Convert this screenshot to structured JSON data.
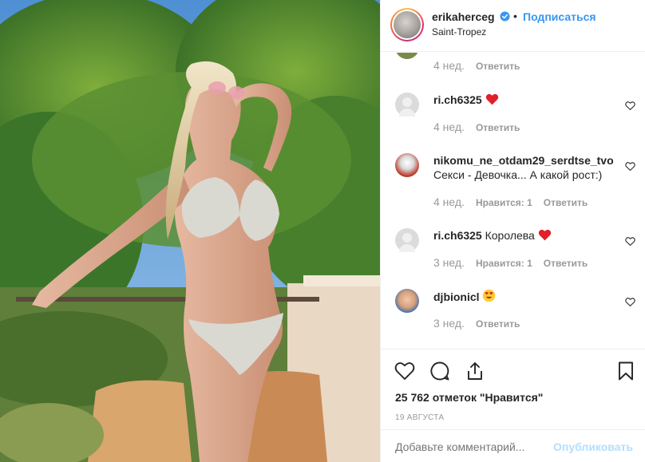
{
  "post": {
    "username": "erikaherceg",
    "subscribe_label": "Подписаться",
    "location": "Saint-Tropez",
    "dot": "•"
  },
  "comments": [
    {
      "time": "4 нед.",
      "reply_label": "Ответить"
    },
    {
      "user": "ri.ch6325",
      "text": "",
      "time": "4 нед.",
      "reply_label": "Ответить",
      "emoji": "heart"
    },
    {
      "user": "nikomu_ne_otdam29_serdtse_tvo",
      "text": "Секси - Девочка... А какой рост:)",
      "time": "4 нед.",
      "likes_label": "Нравится: 1",
      "reply_label": "Ответить"
    },
    {
      "user": "ri.ch6325",
      "text": "Королева",
      "time": "3 нед.",
      "likes_label": "Нравится: 1",
      "reply_label": "Ответить",
      "emoji": "heart"
    },
    {
      "user": "djbionicl",
      "text": "",
      "time": "3 нед.",
      "reply_label": "Ответить",
      "emoji": "heart-eyes"
    }
  ],
  "actions": {
    "icons": [
      "heart-icon",
      "comment-icon",
      "share-icon",
      "bookmark-icon"
    ]
  },
  "likes": "25 762 отметок \"Нравится\"",
  "date": "19 АВГУСТА",
  "add_comment": {
    "placeholder": "Добавьте комментарий...",
    "publish_label": "Опубликовать"
  },
  "colors": {
    "link_blue": "#3897f0",
    "publish_disabled": "#b2dffc",
    "heart_red": "#ed4956",
    "muted": "#999999"
  }
}
